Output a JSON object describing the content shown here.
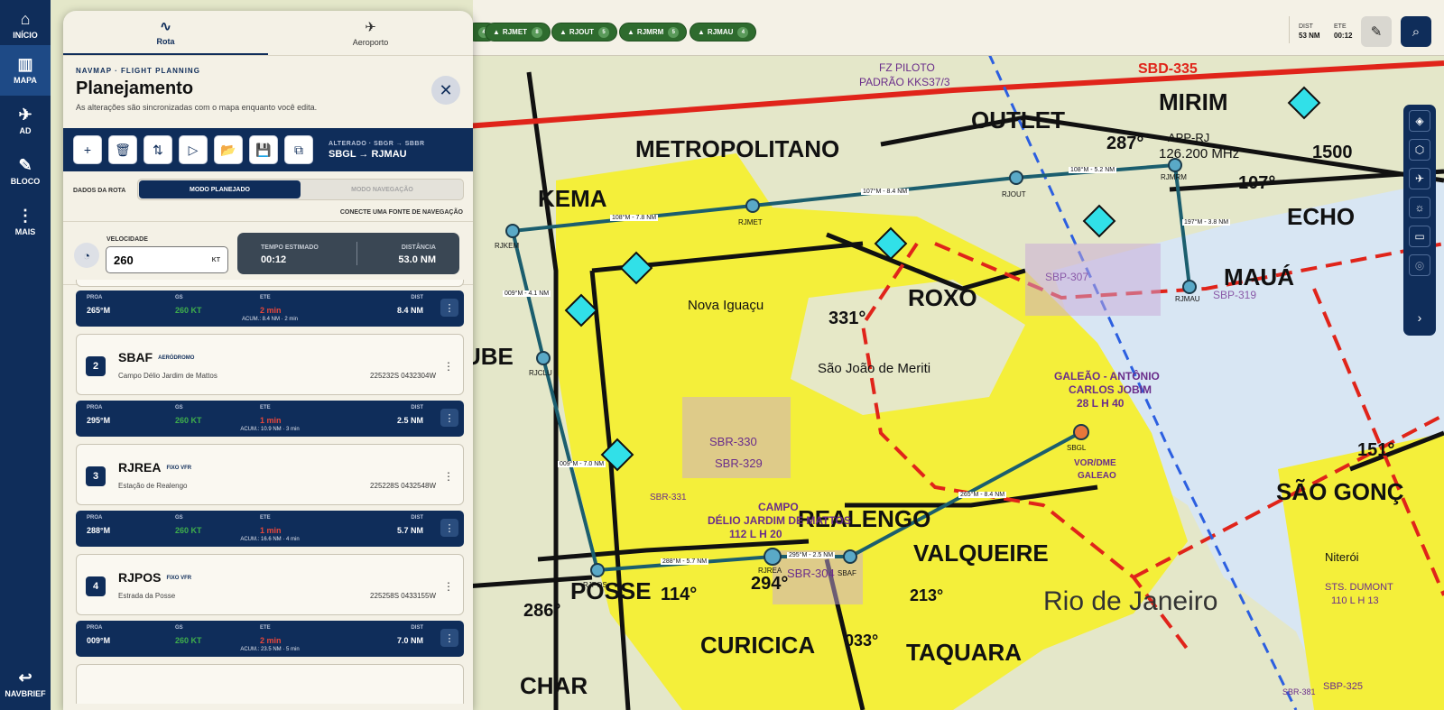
{
  "nav": {
    "items": [
      {
        "label": "INÍCIO",
        "icon": "home-icon",
        "glyph": "⌂"
      },
      {
        "label": "MAPA",
        "icon": "map-icon",
        "glyph": "▥"
      },
      {
        "label": "AD",
        "icon": "airplane-icon",
        "glyph": "✈"
      },
      {
        "label": "BLOCO",
        "icon": "pencil-icon",
        "glyph": "✎"
      },
      {
        "label": "MAIS",
        "icon": "more-vertical-icon",
        "glyph": "⋮"
      }
    ],
    "back_label": "NAVBRIEF"
  },
  "panel": {
    "tabs": [
      {
        "label": "Rota",
        "glyph": "∿"
      },
      {
        "label": "Aeroporto",
        "glyph": "✈"
      }
    ],
    "kicker": "NAVMAP · FLIGHT PLANNING",
    "title": "Planejamento",
    "subtitle": "As alterações são sincronizadas com o mapa enquanto você edita.",
    "toolbar": [
      {
        "name": "add-waypoint",
        "glyph": "+"
      },
      {
        "name": "delete-route",
        "glyph": "🗑"
      },
      {
        "name": "reverse-route",
        "glyph": "⇅"
      },
      {
        "name": "play-route",
        "glyph": "▷"
      },
      {
        "name": "open-route",
        "glyph": "📂"
      },
      {
        "name": "save-route",
        "glyph": "💾"
      },
      {
        "name": "copy-route",
        "glyph": "⧉"
      }
    ],
    "route_status": "ALTERADO · SBGR → SBBR",
    "route": "SBGL → RJMAU",
    "dados_label": "DADOS DA ROTA",
    "mode_planned": "MODO PLANEJADO",
    "mode_nav": "MODO NAVEGAÇÃO",
    "connect": "CONECTE UMA FONTE DE NAVEGAÇÃO",
    "speed_label": "VELOCIDADE",
    "speed": "260",
    "speed_unit": "KT",
    "time_label": "TEMPO ESTIMADO",
    "time": "00:12",
    "dist_label": "DISTÂNCIA",
    "dist": "53.0 NM",
    "leg_labels": {
      "proa": "PROA",
      "gs": "GS",
      "ete": "ETE",
      "dist": "DIST"
    },
    "legs": [
      {
        "proa": "265°M",
        "gs": "260 KT",
        "ete": "2 min",
        "dist": "8.4 NM",
        "acum": "ACUM.: 8.4 NM · 2 min"
      },
      {
        "proa": "295°M",
        "gs": "260 KT",
        "ete": "1 min",
        "dist": "2.5 NM",
        "acum": "ACUM.: 10.9 NM · 3 min"
      },
      {
        "proa": "288°M",
        "gs": "260 KT",
        "ete": "1 min",
        "dist": "5.7 NM",
        "acum": "ACUM.: 16.6 NM · 4 min"
      },
      {
        "proa": "009°M",
        "gs": "260 KT",
        "ete": "2 min",
        "dist": "7.0 NM",
        "acum": "ACUM.: 23.5 NM · 5 min"
      }
    ],
    "waypoints": [
      {
        "n": "2",
        "code": "SBAF",
        "type": "AERÓDROMO",
        "desc": "Campo Délio Jardim de Mattos",
        "coord": "225232S 0432304W"
      },
      {
        "n": "3",
        "code": "RJREA",
        "type": "FIXO VFR",
        "desc": "Estação de Realengo",
        "coord": "225228S 0432548W"
      },
      {
        "n": "4",
        "code": "RJPOS",
        "type": "FIXO VFR",
        "desc": "Estrada da Posse",
        "coord": "225258S 0433155W"
      }
    ]
  },
  "topbar": {
    "chips": [
      {
        "label": "",
        "n": "4"
      },
      {
        "label": "RJMET",
        "n": "8"
      },
      {
        "label": "RJOUT",
        "n": "5"
      },
      {
        "label": "RJMRM",
        "n": "5"
      },
      {
        "label": "RJMAU",
        "n": "4"
      }
    ],
    "dist_label": "DIST",
    "dist": "53 NM",
    "ete_label": "ETE",
    "ete": "00:12"
  },
  "map": {
    "labels": [
      "METROPOLITANO",
      "KEMA",
      "OUTLET",
      "MIRIM",
      "ECHO",
      "ROXO",
      "MAUÁ",
      "REALENGO",
      "VALQUEIRE",
      "POSSE",
      "CURICICA",
      "TAQUARA",
      "SÃO GONÇ",
      "UBE",
      "CHAR",
      "Nova Iguaçu",
      "São João de Meriti",
      "Rio de Janeiro",
      "Niterói",
      "GALEÃO - ANTÔNIO",
      "CARLOS JOBIM",
      "28 L H 40",
      "VOR/DME",
      "GALEAO",
      "CAMPO",
      "DÉLIO JARDIM DE MATTOS",
      "112 L H 20",
      "STS. DUMONT",
      "110 L H 13",
      "SBD-335",
      "SBP-307",
      "SBP-319",
      "SBR-330",
      "SBR-329",
      "SBR-304",
      "SBR-331",
      "SBP-325",
      "SBR-381",
      "FZ PILOTO",
      "PADRÃO KKS37/3",
      "APP-RJ",
      "126.200 MHz",
      "1500",
      "287°",
      "107°",
      "331°",
      "151°",
      "294°",
      "114°",
      "286°",
      "213°",
      "033°"
    ],
    "fixes": [
      "RJKEM",
      "RJMET",
      "RJOUT",
      "RJMRM",
      "RJMAU",
      "RJCLU",
      "RJPOS",
      "RJREA",
      "SBAF",
      "SBGL"
    ],
    "legs": [
      "108°M - 7.8 NM",
      "107°M - 8.4 NM",
      "108°M - 5.2 NM",
      "197°M - 3.8 NM",
      "009°M - 4.1 NM",
      "009°M - 7.0 NM",
      "288°M - 5.7 NM",
      "295°M - 2.5 NM",
      "265°M - 8.4 NM"
    ],
    "colors": {
      "route": "#1b5e6e",
      "yellow": "#f4ef3a",
      "water": "#d8e6f3",
      "land": "#e4e7c9",
      "red": "#e0241a"
    }
  },
  "right_tools": [
    {
      "name": "layers",
      "glyph": "◈"
    },
    {
      "name": "airspace",
      "glyph": "⬡"
    },
    {
      "name": "airport",
      "glyph": "✈"
    },
    {
      "name": "weather",
      "glyph": "☼"
    },
    {
      "name": "ruler",
      "glyph": "▭"
    },
    {
      "name": "location",
      "glyph": "◎"
    },
    {
      "name": "expand",
      "glyph": "›"
    }
  ]
}
